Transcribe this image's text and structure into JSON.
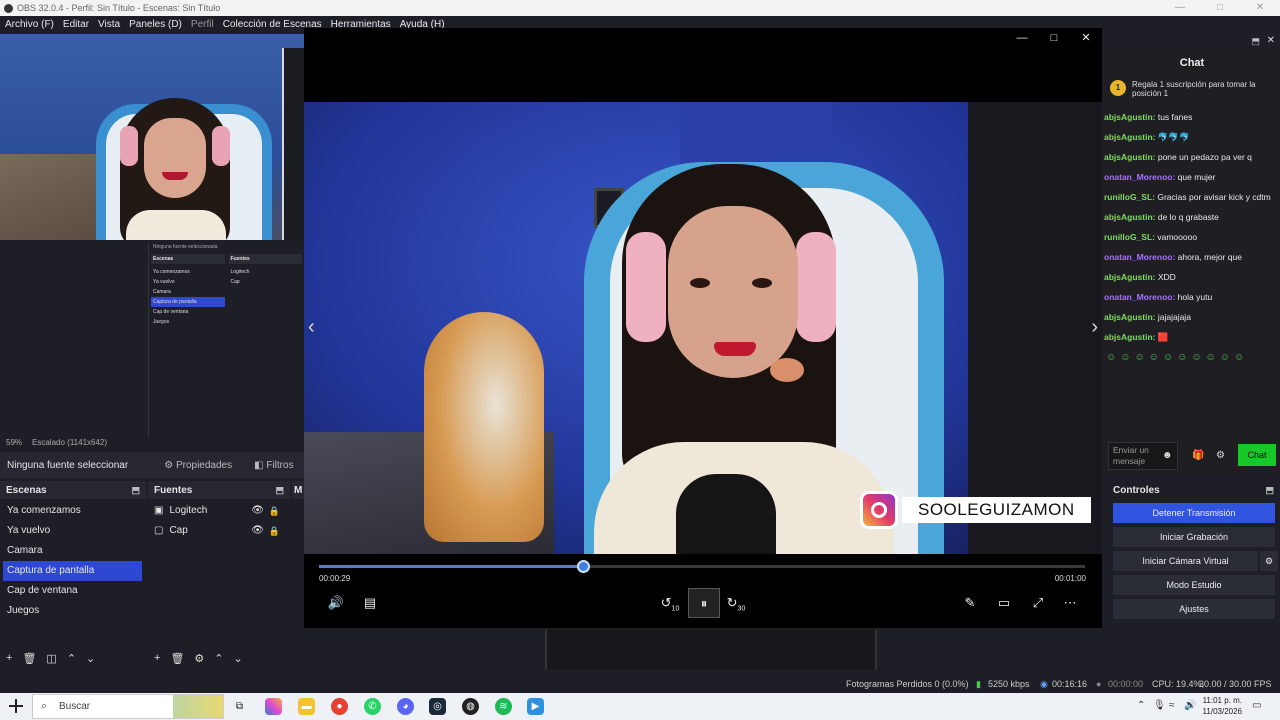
{
  "window": {
    "title": "OBS 32.0.4 - Perfil: Sin Título - Escenas: Sin Título",
    "min": "—",
    "max": "□",
    "close": "✕"
  },
  "menu": [
    "Archivo (F)",
    "Editar",
    "Vista",
    "Paneles (D)",
    "Perfil",
    "Colección de Escenas",
    "Herramientas",
    "Ayuda (H)"
  ],
  "nested_preview": {
    "status": "Ninguna fuente seleccionada",
    "props": "Propiedades",
    "scenes_h": "Escenas",
    "sources_h": "Fuentes",
    "scenes": [
      "Ya comenzamos",
      "Ya vuelvo",
      "Camara",
      "Captura de pantalla",
      "Cap de ventana",
      "Juegos"
    ],
    "sources": [
      "Logitech",
      "Cap"
    ],
    "search": "Buscar"
  },
  "preview_status": {
    "zoom": "59%",
    "scale": "Escalado (1141x642)"
  },
  "source_toolbar": {
    "no_source": "Ninguna fuente seleccionar",
    "properties": "Propiedades",
    "filters": "Filtros"
  },
  "scenes": {
    "header": "Escenas",
    "items": [
      "Ya comenzamos",
      "Ya vuelvo",
      "Camara",
      "Captura de pantalla",
      "Cap de ventana",
      "Juegos"
    ],
    "selected_index": 3
  },
  "sources": {
    "header": "Fuentes",
    "items": [
      {
        "name": "Logitech",
        "icon": "camera-icon"
      },
      {
        "name": "Cap",
        "icon": "window-icon"
      }
    ]
  },
  "mixer_header": "M",
  "player": {
    "overlay_name": "SOOLEGUIZAMON",
    "current_time": "00:00:29",
    "total_time": "00:01:00",
    "progress": 0.345,
    "rewind_label": "10",
    "forward_label": "30"
  },
  "chat": {
    "title": "Chat",
    "gift_rank": "1",
    "gift_text": "Regala 1 suscripción para tomar la posición 1",
    "messages": [
      {
        "user": "abjsAgustin:",
        "text": " tus fanes",
        "color": "#7ddc5a"
      },
      {
        "user": "abjsAgustin:",
        "text": " 🐬🐬🐬",
        "color": "#7ddc5a"
      },
      {
        "user": "abjsAgustin:",
        "text": " pone un pedazo pa ver q",
        "color": "#7ddc5a"
      },
      {
        "user": "onatan_Morenoo:",
        "text": " que mujer",
        "color": "#a970ff"
      },
      {
        "user": "runilloG_SL:",
        "text": " Gracias por avisar kick y cdtm",
        "color": "#7ddc5a"
      },
      {
        "user": "abjsAgustin:",
        "text": " de lo q grabaste",
        "color": "#7ddc5a"
      },
      {
        "user": "runilloG_SL:",
        "text": " vamooooo",
        "color": "#7ddc5a"
      },
      {
        "user": "onatan_Morenoo:",
        "text": " ahora, mejor que",
        "color": "#a970ff"
      },
      {
        "user": "abjsAgustin:",
        "text": " XDD",
        "color": "#7ddc5a"
      },
      {
        "user": "onatan_Morenoo:",
        "text": " hola yutu",
        "color": "#a970ff"
      },
      {
        "user": "abjsAgustin:",
        "text": " jajajajaja",
        "color": "#7ddc5a"
      },
      {
        "user": "abjsAgustin:",
        "text": " 🟥",
        "color": "#7ddc5a"
      }
    ],
    "input_placeholder": "Enviar un mensaje",
    "send": "Chat"
  },
  "controls": {
    "header": "Controles",
    "stop_stream": "Detener Transmisión",
    "start_rec": "Iniciar Grabación",
    "virtual_cam": "Iniciar Cámara Virtual",
    "studio": "Modo Estudio",
    "settings": "Ajustes"
  },
  "statusbar": {
    "dropped": "Fotogramas Perdidos 0 (0.0%)",
    "bitrate": "5250 kbps",
    "stream_time": "00:16:16",
    "rec_time": "00:00:00",
    "cpu": "CPU: 19.4%,",
    "fps": "30.00 / 30.00 FPS"
  },
  "taskbar": {
    "search": "Buscar",
    "time": "11:01 p. m.",
    "date": "11/03/2026"
  },
  "colors": {
    "accent": "#2f48d4",
    "stream_active": "#3154e0",
    "chat_send": "#18c728"
  }
}
